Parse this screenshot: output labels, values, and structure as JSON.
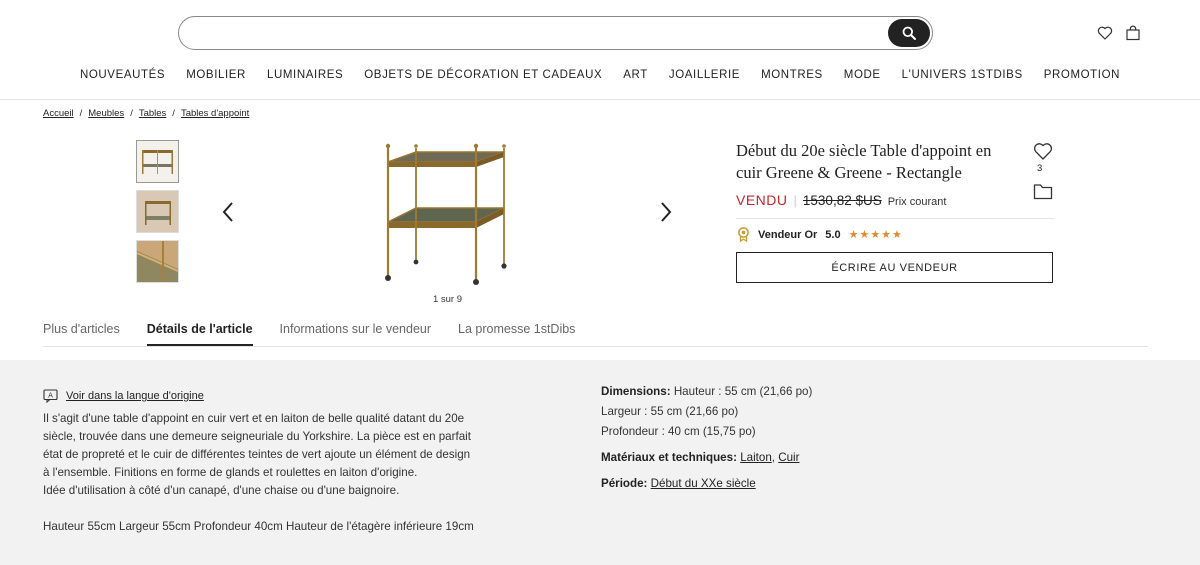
{
  "header": {
    "search": {
      "placeholder": ""
    },
    "nav": [
      "NOUVEAUTÉS",
      "MOBILIER",
      "LUMINAIRES",
      "OBJETS DE DÉCORATION ET CADEAUX",
      "ART",
      "JOAILLERIE",
      "MONTRES",
      "MODE",
      "L'UNIVERS 1STDIBS",
      "PROMOTION"
    ]
  },
  "breadcrumb": [
    "Accueil",
    "Meubles",
    "Tables",
    "Tables d'appoint"
  ],
  "gallery": {
    "counter": "1 sur 9"
  },
  "product": {
    "title": "Début du 20e siècle Table d'appoint en cuir Greene & Greene - Rectangle",
    "favorite_count": "3",
    "sold_label": "VENDU",
    "old_price": "1530,82 $US",
    "price_note": "Prix courant",
    "seller_label": "Vendeur Or",
    "seller_rating": "5.0",
    "stars": "★★★★★",
    "contact_label": "ÉCRIRE AU VENDEUR"
  },
  "tabs": [
    "Plus d'articles",
    "Détails de l'article",
    "Informations sur le vendeur",
    "La promesse 1stDibs"
  ],
  "active_tab": 1,
  "details": {
    "translate_link": "Voir dans la langue d'origine",
    "description": [
      "Il s'agit d'une table d'appoint en cuir vert et en laiton de belle qualité datant du 20e",
      "siècle, trouvée dans une demeure seigneuriale du Yorkshire. La pièce est en parfait",
      "état de propreté et le cuir de différentes teintes de vert ajoute un élément de design",
      "à l'ensemble. Finitions en forme de glands et roulettes en laiton d'origine.",
      "Idée d'utilisation à côté d'un canapé, d'une chaise ou d'une baignoire.",
      "",
      "Hauteur 55cm Largeur 55cm Profondeur 40cm Hauteur de l'étagère inférieure 19cm"
    ],
    "dimensions_label": "Dimensions:",
    "height": "Hauteur : 55 cm (21,66 po)",
    "width": "Largeur : 55 cm (21,66 po)",
    "depth": "Profondeur : 40 cm (15,75 po)",
    "materials_label": "Matériaux et techniques:",
    "material_1": "Laiton",
    "material_sep": ", ",
    "material_2": "Cuir",
    "period_label": "Période:",
    "period_value": "Début du XXe siècle"
  },
  "colors": {
    "sold": "#c2262e",
    "stars": "#e08a2c",
    "panel": "#f2f2f2"
  }
}
